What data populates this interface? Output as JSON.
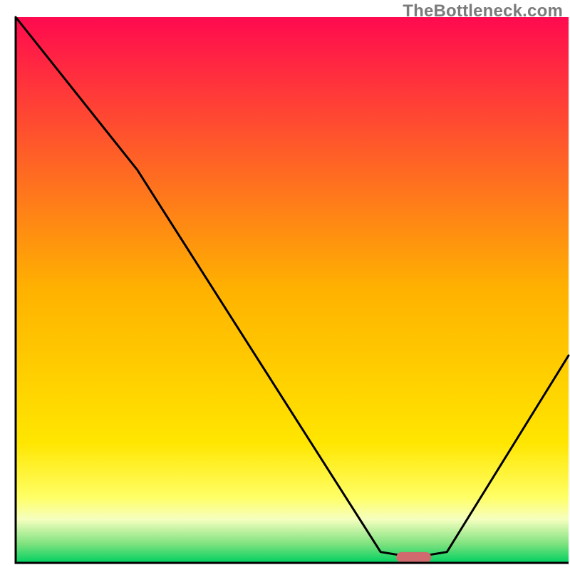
{
  "watermark": "TheBottleneck.com",
  "chart_data": {
    "type": "line",
    "title": "",
    "xlabel": "",
    "ylabel": "",
    "xlim": [
      0,
      100
    ],
    "ylim": [
      0,
      100
    ],
    "x": [
      0,
      22,
      66,
      72,
      78,
      100
    ],
    "values": [
      100,
      72,
      2,
      1,
      2,
      38
    ],
    "marker": {
      "x": 72,
      "y": 1
    },
    "background_gradient": {
      "stops": [
        {
          "offset": 0.0,
          "color": "#ff0a4f"
        },
        {
          "offset": 0.5,
          "color": "#ffb200"
        },
        {
          "offset": 0.78,
          "color": "#ffe600"
        },
        {
          "offset": 0.88,
          "color": "#ffff66"
        },
        {
          "offset": 0.92,
          "color": "#f6ffbf"
        },
        {
          "offset": 0.965,
          "color": "#7fe27f"
        },
        {
          "offset": 1.0,
          "color": "#00d060"
        }
      ]
    },
    "colors": {
      "line": "#000000",
      "axis": "#000000",
      "marker_fill": "#d06a6e",
      "marker_stroke": "#d06a6e"
    }
  }
}
